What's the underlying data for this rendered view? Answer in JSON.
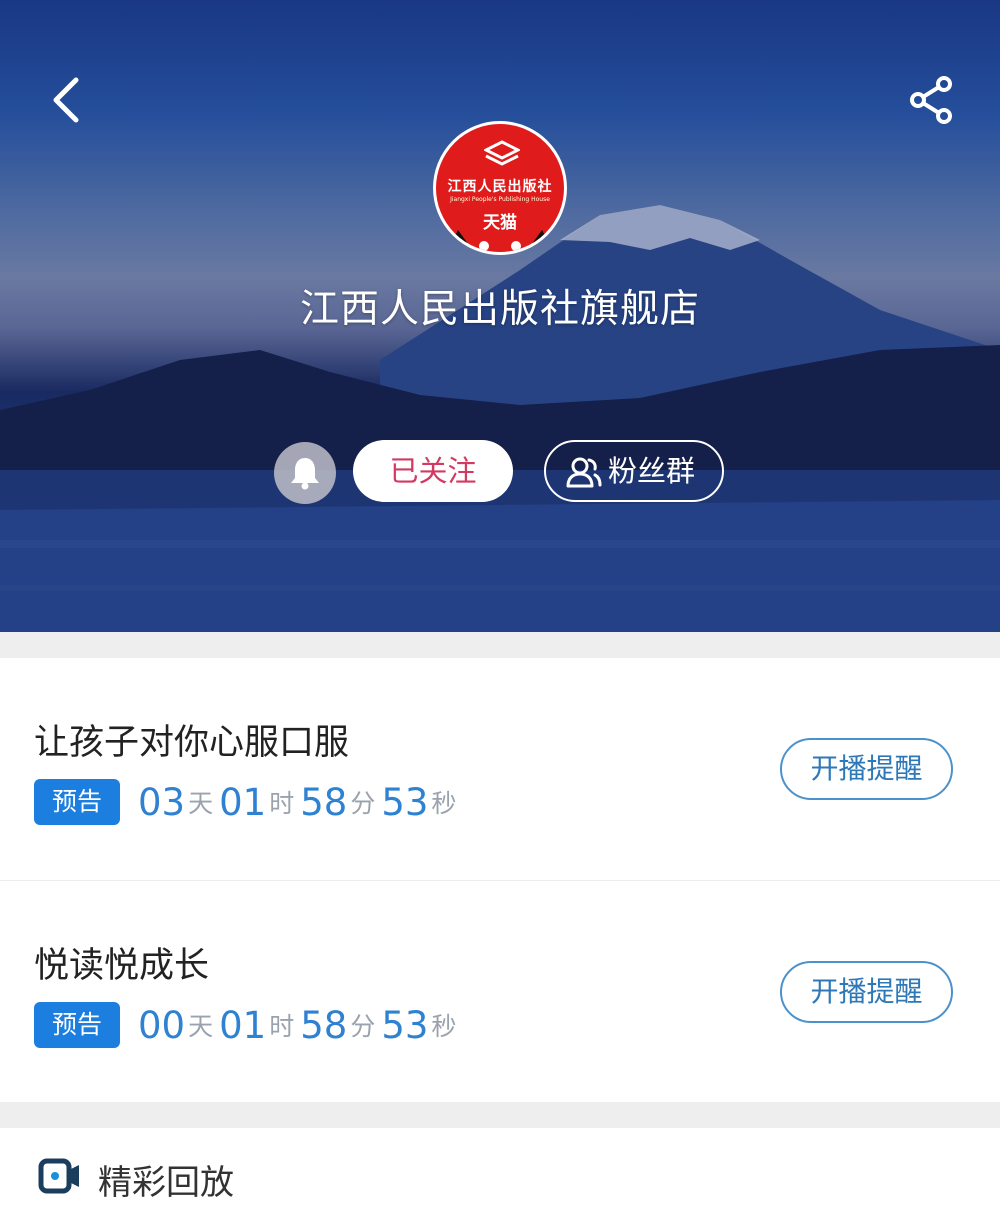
{
  "header": {
    "logo": {
      "name_cn": "江西人民出版社",
      "name_en": "Jiangxi People's Publishing House",
      "badge": "天猫"
    },
    "store_name": "江西人民出版社旗舰店",
    "follow_label": "已关注",
    "fans_label": "粉丝群"
  },
  "lives": [
    {
      "title": "让孩子对你心服口服",
      "badge": "预告",
      "days": "03",
      "days_unit": "天",
      "hours": "01",
      "hours_unit": "时",
      "minutes": "58",
      "minutes_unit": "分",
      "seconds": "53",
      "seconds_unit": "秒",
      "remind_label": "开播提醒"
    },
    {
      "title": "悦读悦成长",
      "badge": "预告",
      "days": "00",
      "days_unit": "天",
      "hours": "01",
      "hours_unit": "时",
      "minutes": "58",
      "minutes_unit": "分",
      "seconds": "53",
      "seconds_unit": "秒",
      "remind_label": "开播提醒"
    }
  ],
  "replay": {
    "label": "精彩回放"
  },
  "icons": {
    "back": "chevron-left-icon",
    "share": "share-icon",
    "bell": "bell-icon",
    "fans": "users-icon",
    "replay": "video-camera-icon"
  },
  "colors": {
    "follow_text": "#d23a62",
    "badge_bg": "#1c7ede",
    "countdown_number": "#2f82d2",
    "remind_border": "#4b91cc",
    "logo_red": "#e01b1b"
  }
}
